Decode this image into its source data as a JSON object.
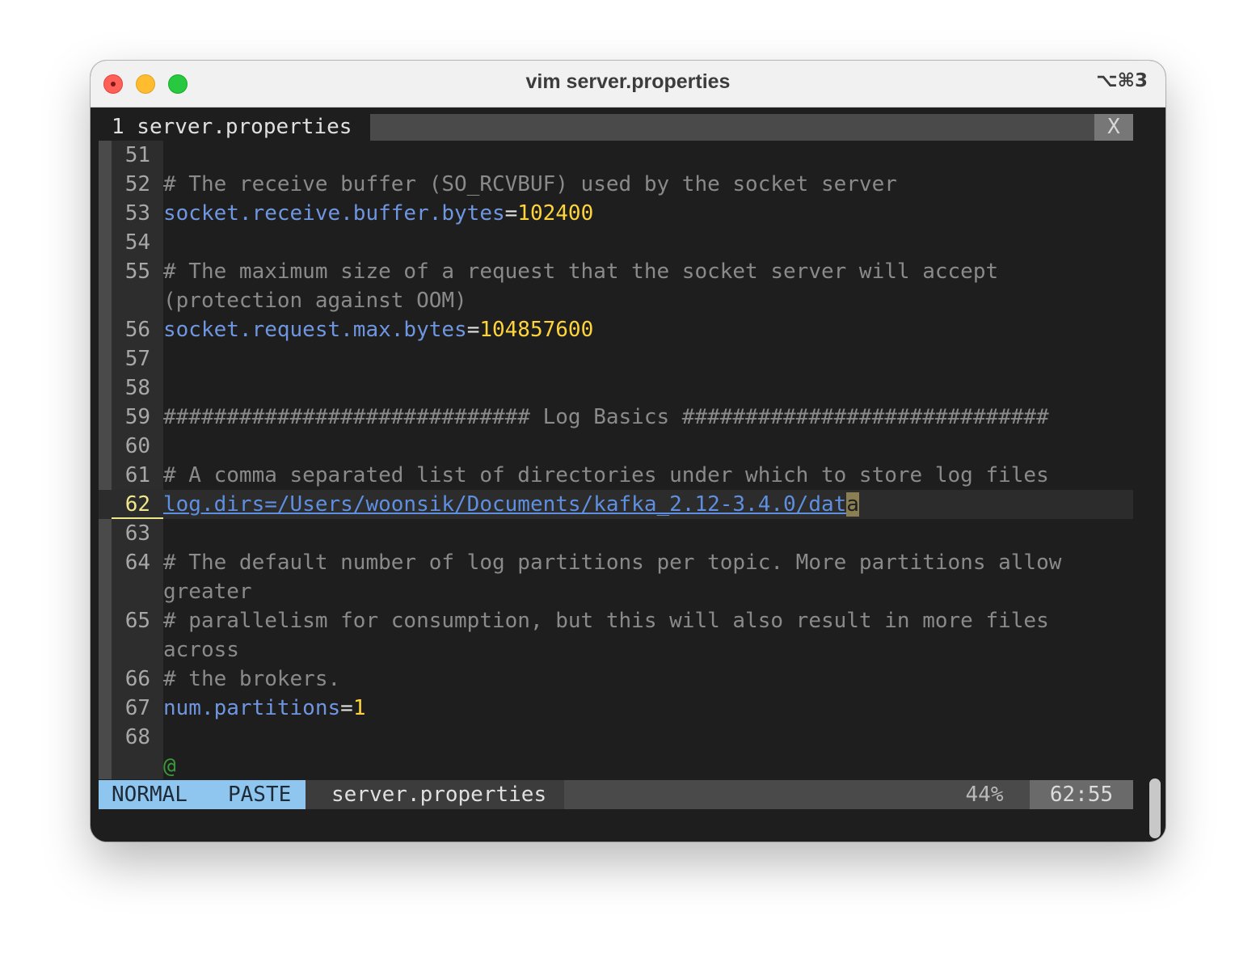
{
  "window": {
    "title": "vim server.properties",
    "shortcut": "⌥⌘3"
  },
  "tabline": {
    "tab_label": "1 server.properties",
    "close_label": "X"
  },
  "editor": {
    "lines": [
      {
        "num": "51",
        "parts": []
      },
      {
        "num": "52",
        "parts": [
          {
            "t": "# The receive buffer (SO_RCVBUF) used by the socket server",
            "c": "com"
          }
        ]
      },
      {
        "num": "53",
        "parts": [
          {
            "t": "socket.receive.buffer.bytes",
            "c": "key"
          },
          {
            "t": "=",
            "c": "eq"
          },
          {
            "t": "102400",
            "c": "num"
          }
        ]
      },
      {
        "num": "54",
        "parts": []
      },
      {
        "num": "55",
        "parts": [
          {
            "t": "# The maximum size of a request that the socket server will accept",
            "c": "com"
          }
        ]
      },
      {
        "num": "",
        "parts": [
          {
            "t": "(protection against OOM)",
            "c": "com"
          }
        ]
      },
      {
        "num": "56",
        "parts": [
          {
            "t": "socket.request.max.bytes",
            "c": "key"
          },
          {
            "t": "=",
            "c": "eq"
          },
          {
            "t": "104857600",
            "c": "num"
          }
        ]
      },
      {
        "num": "57",
        "parts": []
      },
      {
        "num": "58",
        "parts": []
      },
      {
        "num": "59",
        "parts": [
          {
            "t": "############################# Log Basics #############################",
            "c": "com"
          }
        ]
      },
      {
        "num": "60",
        "parts": []
      },
      {
        "num": "61",
        "parts": [
          {
            "t": "# A comma separated list of directories under which to store log files",
            "c": "com"
          }
        ]
      },
      {
        "num": "62",
        "current": true,
        "parts": [
          {
            "t": "log.dirs=/Users/woonsik/Documents/kafka_2.12-3.4.0/dat",
            "c": "link"
          },
          {
            "t": "a",
            "c": "cursor"
          }
        ]
      },
      {
        "num": "63",
        "parts": []
      },
      {
        "num": "64",
        "parts": [
          {
            "t": "# The default number of log partitions per topic. More partitions allow",
            "c": "com"
          }
        ]
      },
      {
        "num": "",
        "parts": [
          {
            "t": "greater",
            "c": "com"
          }
        ]
      },
      {
        "num": "65",
        "parts": [
          {
            "t": "# parallelism for consumption, but this will also result in more files",
            "c": "com"
          }
        ]
      },
      {
        "num": "",
        "parts": [
          {
            "t": "across",
            "c": "com"
          }
        ]
      },
      {
        "num": "66",
        "parts": [
          {
            "t": "# the brokers.",
            "c": "com"
          }
        ]
      },
      {
        "num": "67",
        "parts": [
          {
            "t": "num.partitions",
            "c": "key"
          },
          {
            "t": "=",
            "c": "eq"
          },
          {
            "t": "1",
            "c": "num"
          }
        ]
      },
      {
        "num": "68",
        "parts": []
      },
      {
        "num": "",
        "parts": [
          {
            "t": "@",
            "c": "at"
          }
        ]
      }
    ]
  },
  "statusline": {
    "mode": "NORMAL",
    "paste": "PASTE",
    "filename": "server.properties",
    "percent": "44%",
    "position": "62:55"
  },
  "colors": {
    "mode_bg": "#8fc6f0",
    "key": "#6f96e0",
    "number": "#ffd43b",
    "comment": "#8a8a8a",
    "current_line_number": "#f0e68c"
  }
}
